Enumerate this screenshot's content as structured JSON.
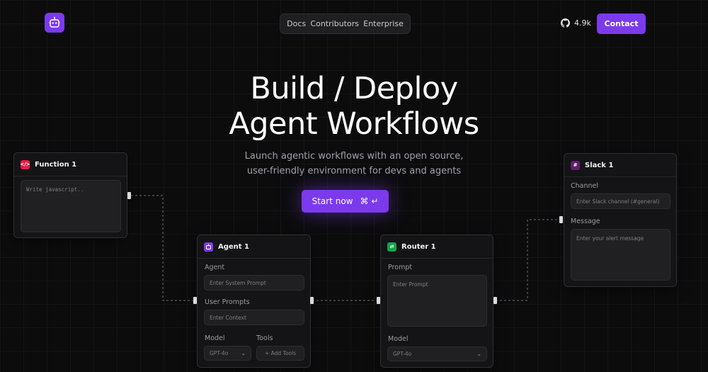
{
  "header": {
    "nav": [
      "Docs",
      "Contributors",
      "Enterprise"
    ],
    "github_stars": "4.9k",
    "contact_label": "Contact"
  },
  "hero": {
    "title_line1": "Build / Deploy",
    "title_line2": "Agent Workflows",
    "subtitle_line1": "Launch agentic workflows with an open source,",
    "subtitle_line2": "user-friendly environment for devs and agents",
    "cta_label": "Start now",
    "cta_shortcut": "⌘ ↵"
  },
  "nodes": {
    "function": {
      "title": "Function 1",
      "code_placeholder": "Write javascript.."
    },
    "agent": {
      "title": "Agent 1",
      "agent_label": "Agent",
      "agent_placeholder": "Enter System Prompt",
      "user_prompts_label": "User Prompts",
      "user_prompts_placeholder": "Enter Context",
      "model_label": "Model",
      "model_value": "GPT-4o",
      "tools_label": "Tools",
      "tools_button": "+ Add Tools"
    },
    "router": {
      "title": "Router 1",
      "prompt_label": "Prompt",
      "prompt_placeholder": "Enter Prompt",
      "model_label": "Model",
      "model_value": "GPT-4o"
    },
    "slack": {
      "title": "Slack 1",
      "channel_label": "Channel",
      "channel_placeholder": "Enter Slack channel (#general)",
      "message_label": "Message",
      "message_placeholder": "Enter your alert message"
    }
  },
  "colors": {
    "accent": "#7c3aed",
    "function_icon": "#e11d48",
    "agent_icon": "#7c3aed",
    "router_icon": "#16a34a",
    "slack_icon": "#611f69"
  },
  "icons": {
    "logo": "robot-icon",
    "github": "github-icon",
    "function": "code-icon",
    "agent": "robot-icon",
    "router": "route-icon",
    "slack": "slack-icon"
  }
}
